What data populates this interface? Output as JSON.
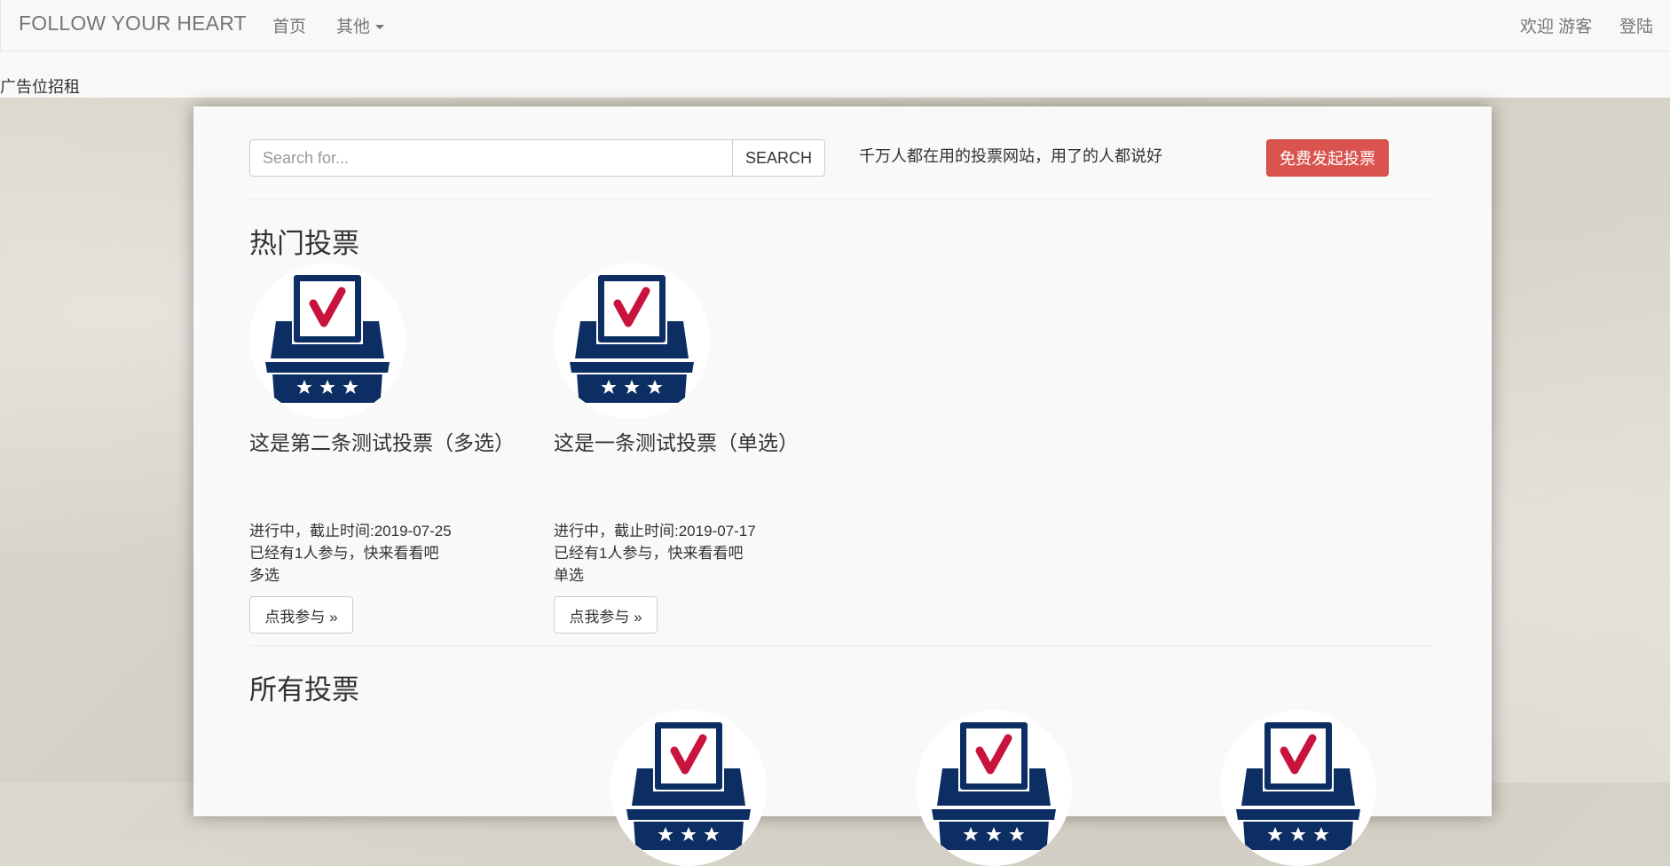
{
  "navbar": {
    "brand": "FOLLOW YOUR HEART",
    "home": "首页",
    "other": "其他",
    "welcome": "欢迎 游客",
    "login": "登陆"
  },
  "ad": {
    "text": "广告位招租"
  },
  "search": {
    "placeholder": "Search for...",
    "value": "",
    "button": "SEARCH"
  },
  "slogan": "千万人都在用的投票网站，用了的人都说好",
  "cta_button": "免费发起投票",
  "hot": {
    "title": "热门投票",
    "items": [
      {
        "title": "这是第二条测试投票（多选）",
        "status": "进行中，截止时间:2019-07-25",
        "participants": "已经有1人参与，快来看看吧",
        "type": "多选",
        "button": "点我参与 »"
      },
      {
        "title": "这是一条测试投票（单选）",
        "status": "进行中，截止时间:2019-07-17",
        "participants": "已经有1人参与，快来看看吧",
        "type": "单选",
        "button": "点我参与 »"
      }
    ]
  },
  "all": {
    "title": "所有投票"
  },
  "colors": {
    "accent_red": "#d9534f",
    "icon_navy": "#0c2e63",
    "check_red": "#c8143c"
  },
  "icons": [
    "ballot-box-icon",
    "caret-down-icon"
  ]
}
